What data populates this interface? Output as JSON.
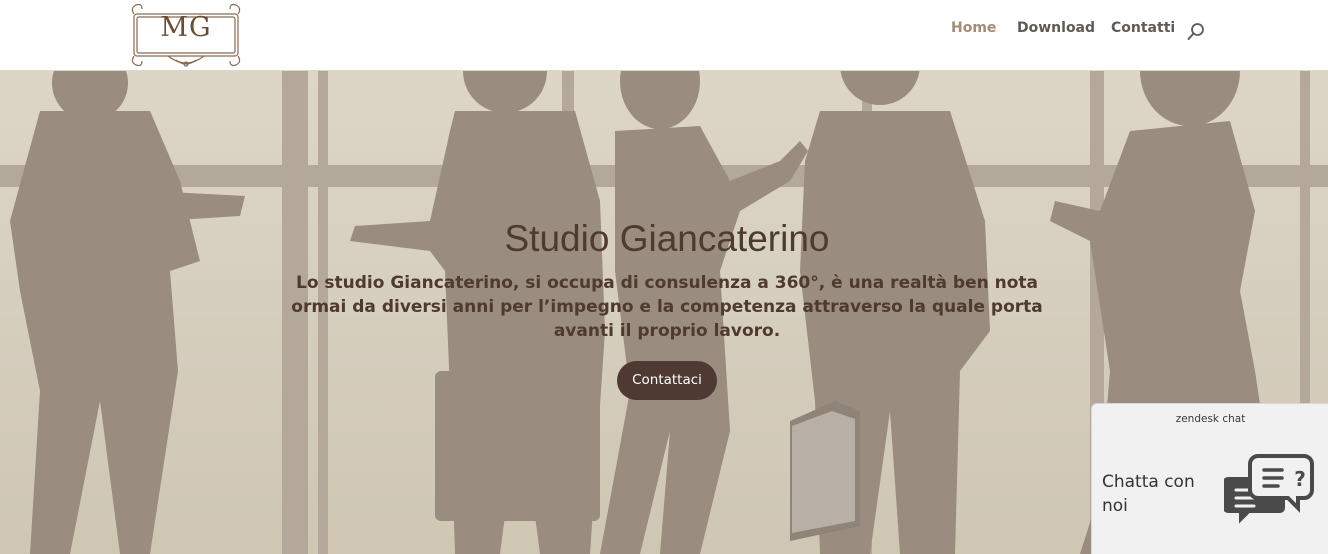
{
  "logo": {
    "text": "MG"
  },
  "nav": {
    "items": [
      {
        "label": "Home",
        "active": true
      },
      {
        "label": "Download",
        "active": false
      },
      {
        "label": "Contatti",
        "active": false
      }
    ],
    "search_icon": "search-icon"
  },
  "hero": {
    "title": "Studio Giancaterino",
    "text": "Lo studio Giancaterino, si occupa di consulenza a 360°, è una realtà ben nota ormai da diversi anni per l’impegno e la competenza attraverso la quale porta avanti il proprio lavoro.",
    "cta_label": "Contattaci"
  },
  "chat": {
    "brand": "zendesk chat",
    "label": "Chatta con noi",
    "icon": "chat-bubbles-icon"
  },
  "colors": {
    "accent": "#a68b77",
    "nav_text": "#5f5a55",
    "hero_text": "#4e3a2e",
    "button_bg": "#4e3a33",
    "hero_bg": "#d5cdbd",
    "silhouette": "#9a8c7e"
  }
}
